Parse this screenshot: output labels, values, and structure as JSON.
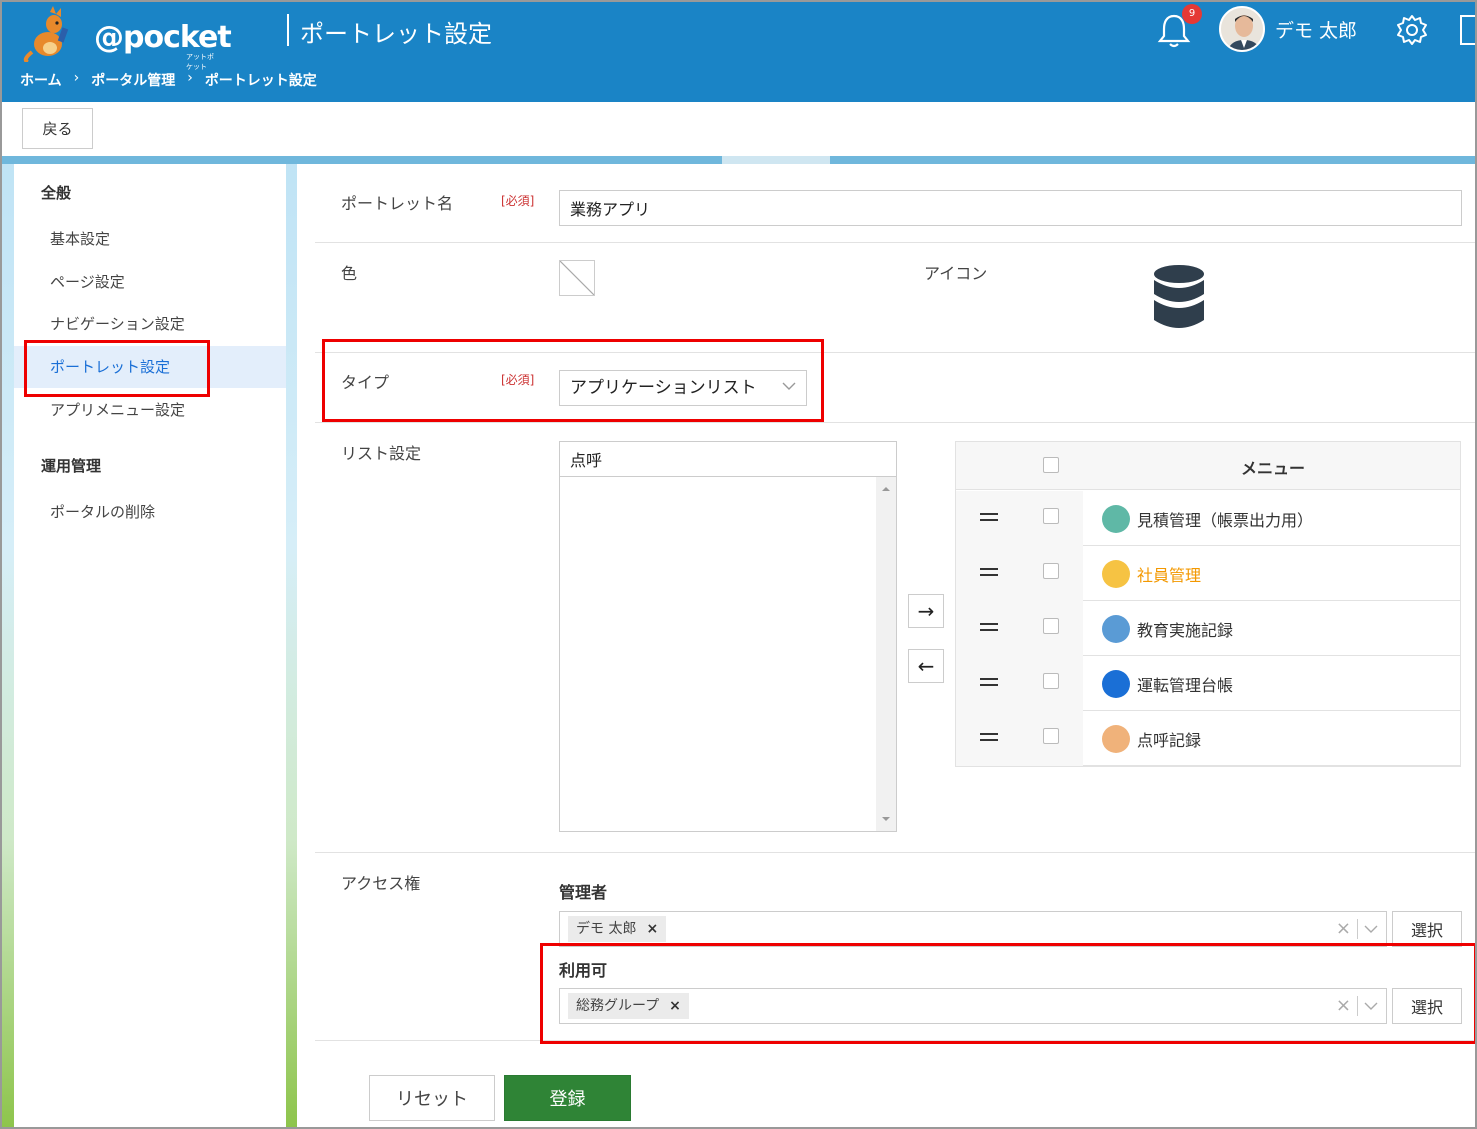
{
  "header": {
    "logo_text": "@pocket",
    "logo_sub": "アットポケット",
    "title": "ポートレット設定",
    "breadcrumb": [
      "ホーム",
      "ポータル管理",
      "ポートレット設定"
    ],
    "breadcrumb_sep": "›",
    "notification_count": "9",
    "user_name": "デモ 太郎"
  },
  "toolbar": {
    "back_label": "戻る"
  },
  "sidebar": {
    "section1": "全般",
    "items": [
      "基本設定",
      "ページ設定",
      "ナビゲーション設定",
      "ポートレット設定",
      "アプリメニュー設定"
    ],
    "section2": "運用管理",
    "items2": [
      "ポータルの削除"
    ]
  },
  "form": {
    "name_label": "ポートレット名",
    "required": "[必須]",
    "name_value": "業務アプリ",
    "color_label": "色",
    "icon_label": "アイコン",
    "type_label": "タイプ",
    "type_value": "アプリケーションリスト",
    "list_label": "リスト設定",
    "list_search_value": "点呼",
    "arrow_right": "→",
    "arrow_left": "←",
    "menu_header": "メニュー",
    "menu_items": [
      {
        "label": "見積管理（帳票出力用）",
        "color": "#5fb8a6"
      },
      {
        "label": "社員管理",
        "color": "#f6c343"
      },
      {
        "label": "教育実施記録",
        "color": "#5a9bd5"
      },
      {
        "label": "運転管理台帳",
        "color": "#1a6fd6"
      },
      {
        "label": "点呼記録",
        "color": "#f0b27a"
      }
    ],
    "access_label": "アクセス権",
    "admin_label": "管理者",
    "admin_tag": "デモ 太郎",
    "usable_label": "利用可",
    "usable_tag": "総務グループ",
    "tag_remove": "×",
    "clear": "×",
    "select_label": "選択",
    "reset_label": "リセット",
    "submit_label": "登録"
  },
  "colors": {
    "header_bg": "#1a84c6",
    "active_item": "#1a6fd6",
    "submit_bg": "#2f8436",
    "highlight": "#e00000"
  }
}
